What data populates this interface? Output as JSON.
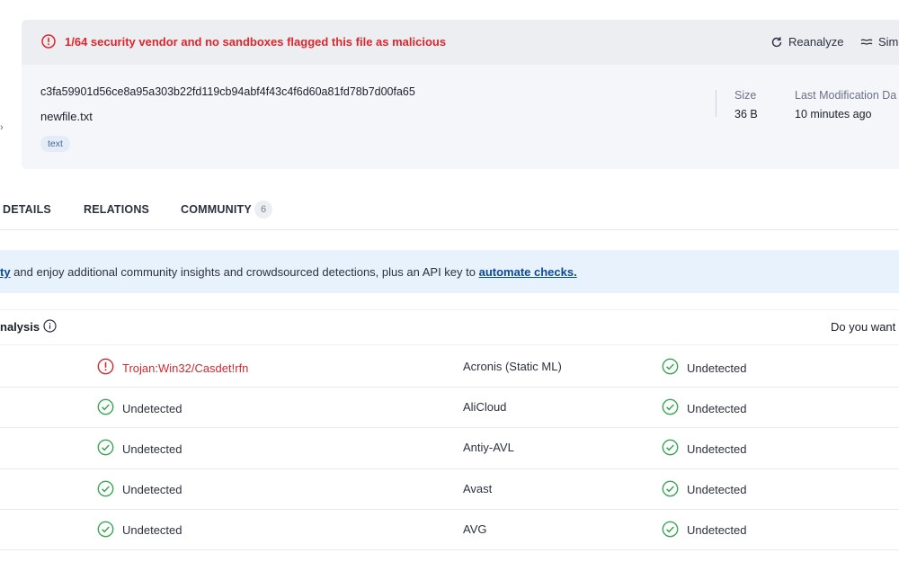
{
  "header": {
    "alert_text": "1/64 security vendor and no sandboxes flagged this file as malicious",
    "reanalyze_label": "Reanalyze",
    "similar_label": "Sim",
    "hash": "c3fa59901d56ce8a95a303b22fd119cb94abf4f43c4f6d60a81fd78b7d00fa65",
    "filename": "newfile.txt",
    "tag": "text",
    "size_label": "Size",
    "size_value": "36 B",
    "lastmod_label": "Last Modification Da",
    "lastmod_value": "10 minutes ago"
  },
  "tabs": {
    "details": "DETAILS",
    "relations": "RELATIONS",
    "community": "COMMUNITY",
    "community_count": "6"
  },
  "promo": {
    "link1": "ty",
    "text": " and enjoy additional community insights and crowdsourced detections, plus an API key to ",
    "link2": "automate checks."
  },
  "analysis": {
    "title": "nalysis",
    "right_text": "Do you want t"
  },
  "rows": [
    {
      "left_status": "Trojan:Win32/Casdet!rfn",
      "left_malicious": true,
      "vendor": "Acronis (Static ML)",
      "right_status": "Undetected"
    },
    {
      "left_status": "Undetected",
      "left_malicious": false,
      "vendor": "AliCloud",
      "right_status": "Undetected"
    },
    {
      "left_status": "Undetected",
      "left_malicious": false,
      "vendor": "Antiy-AVL",
      "right_status": "Undetected"
    },
    {
      "left_status": "Undetected",
      "left_malicious": false,
      "vendor": "Avast",
      "right_status": "Undetected"
    },
    {
      "left_status": "Undetected",
      "left_malicious": false,
      "vendor": "AVG",
      "right_status": "Undetected"
    }
  ],
  "colors": {
    "malicious": "#d6282d",
    "undetected": "#3aa655",
    "link": "#0b4a99"
  }
}
